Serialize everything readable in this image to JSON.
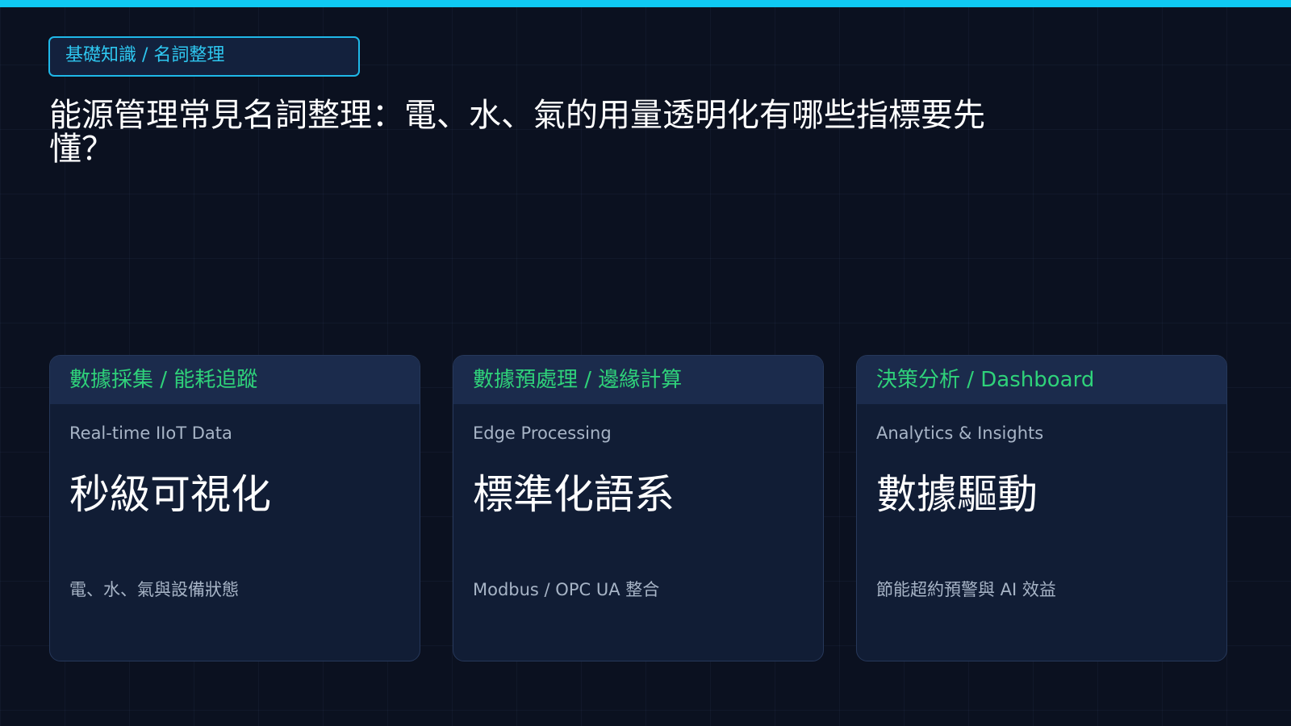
{
  "header": {
    "tag": "基礎知識 / 名詞整理",
    "title": "能源管理常見名詞整理：電、水、氣的用量透明化有哪些指標要先懂？"
  },
  "colors": {
    "accent_cyan": "#0fc9f2",
    "accent_green": "#2fd27a",
    "background": "#0b1120",
    "card_background": "#111d35"
  },
  "cards": [
    {
      "heading": "數據採集 / 能耗追蹤",
      "subtitle": "Real-time IIoT Data",
      "value": "秒級可視化",
      "description": "電、水、氣與設備狀態"
    },
    {
      "heading": "數據預處理 / 邊緣計算",
      "subtitle": "Edge Processing",
      "value": "標準化語系",
      "description": "Modbus / OPC UA 整合"
    },
    {
      "heading": "決策分析 / Dashboard",
      "subtitle": "Analytics & Insights",
      "value": "數據驅動",
      "description": "節能超約預警與 AI 效益"
    }
  ]
}
